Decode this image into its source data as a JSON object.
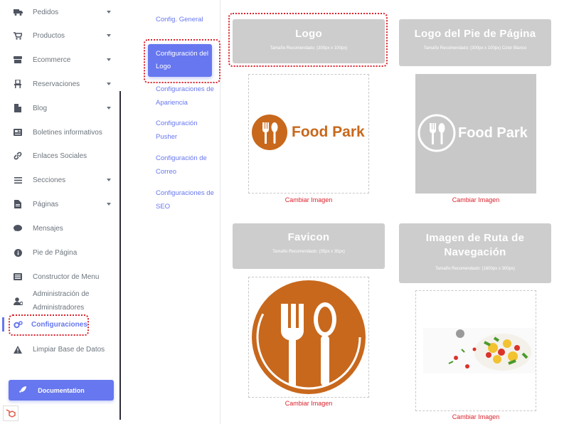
{
  "sidebar": {
    "items": [
      {
        "label": "Pedidos",
        "icon": "truck-icon",
        "dropdown": true
      },
      {
        "label": "Productos",
        "icon": "cart-icon",
        "dropdown": true
      },
      {
        "label": "Ecommerce",
        "icon": "store-icon",
        "dropdown": true
      },
      {
        "label": "Reservaciones",
        "icon": "chair-icon",
        "dropdown": true
      },
      {
        "label": "Blog",
        "icon": "file-icon",
        "dropdown": true
      },
      {
        "label": "Boletines informativos",
        "icon": "newspaper-icon",
        "dropdown": false
      },
      {
        "label": "Enlaces Sociales",
        "icon": "link-icon",
        "dropdown": false
      },
      {
        "label": "Secciones",
        "icon": "bars-icon",
        "dropdown": true
      },
      {
        "label": "Páginas",
        "icon": "page-icon",
        "dropdown": true
      },
      {
        "label": "Mensajes",
        "icon": "chat-icon",
        "dropdown": false
      },
      {
        "label": "Pie de Página",
        "icon": "info-icon",
        "dropdown": false
      },
      {
        "label": "Constructor de Menu",
        "icon": "list-icon",
        "dropdown": false
      },
      {
        "label": "Administración de Administradores",
        "icon": "user-gear-icon",
        "dropdown": false
      },
      {
        "label": "Configuraciones",
        "icon": "cogs-icon",
        "dropdown": false,
        "active": true
      },
      {
        "label": "Limpiar Base de Datos",
        "icon": "warning-icon",
        "dropdown": false
      }
    ],
    "documentation_label": "Documentation"
  },
  "settings_menu": {
    "items": [
      {
        "label": "Config. General"
      },
      {
        "label": "Configuración del Logo",
        "active": true
      },
      {
        "label": "Configuraciones de Apariencia"
      },
      {
        "label": "Configuración Pusher"
      },
      {
        "label": "Configuración de Correo"
      },
      {
        "label": "Configuraciones de SEO"
      }
    ]
  },
  "cards": {
    "logo": {
      "title": "Logo",
      "subtitle": "Tamaño Recomendado: (300px x 100px)",
      "image_text": "Food Park",
      "change_label": "Cambiar Imagen"
    },
    "footer_logo": {
      "title": "Logo del Pie de Página",
      "subtitle": "Tamaño Recomendado: (300px x 100px) Color Blanco",
      "image_text": "Food Park",
      "change_label": "Cambiar Imagen"
    },
    "favicon": {
      "title": "Favicon",
      "subtitle": "Tamaño Recomendado: (35px x 35px)",
      "change_label": "Cambiar Imagen"
    },
    "breadcrumb": {
      "title": "Imagen de Ruta de Navegación",
      "subtitle": "Tamaño Recomendado: (1600px x 300px)",
      "change_label": "Cambiar Imagen"
    }
  },
  "colors": {
    "primary": "#6777ef",
    "accent_red": "#d9232d",
    "brand_orange": "#c8681c",
    "card_gray": "#cdcdcd"
  }
}
